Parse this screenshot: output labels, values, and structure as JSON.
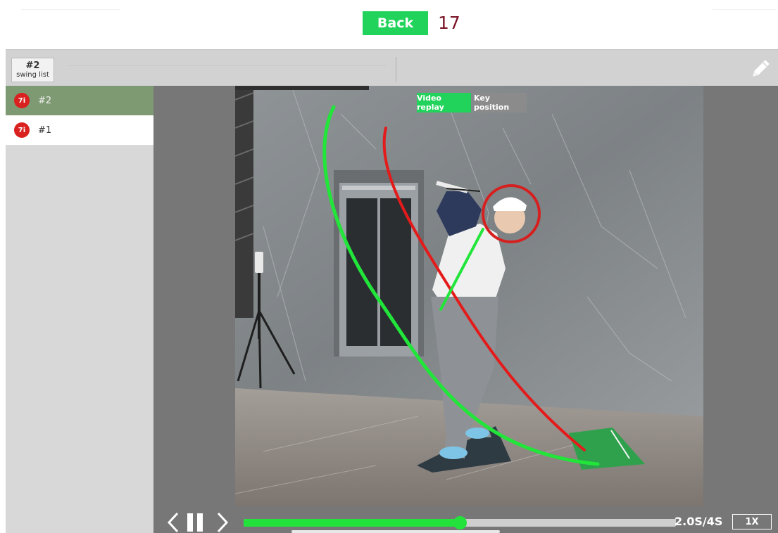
{
  "header": {
    "back_label": "Back",
    "swing_count": "17"
  },
  "toolbar": {
    "swing_list_number": "#2",
    "swing_list_label": "swing list",
    "edit_icon": "pencil-icon"
  },
  "sidebar": {
    "items": [
      {
        "club": "7i",
        "name": "#2",
        "selected": true
      },
      {
        "club": "7i",
        "name": "#1",
        "selected": false
      }
    ]
  },
  "video": {
    "modes": [
      {
        "label": "Video replay",
        "active": true
      },
      {
        "label": "Key position",
        "active": false
      }
    ],
    "overlay_colors": {
      "plane_line": "#22e53a",
      "head_path": "#e31b1b",
      "head_circle": "#d62020"
    }
  },
  "playback": {
    "prev_icon": "chevron-left-icon",
    "pause_icon": "pause-icon",
    "next_icon": "chevron-right-icon",
    "progress_fraction": 0.5,
    "time_text": "2.0S/4S",
    "speed_label": "1X"
  },
  "colors": {
    "accent": "#21d35b",
    "counter": "#7b1527",
    "badge": "#d9211f",
    "selected_row": "#7e9a72"
  }
}
